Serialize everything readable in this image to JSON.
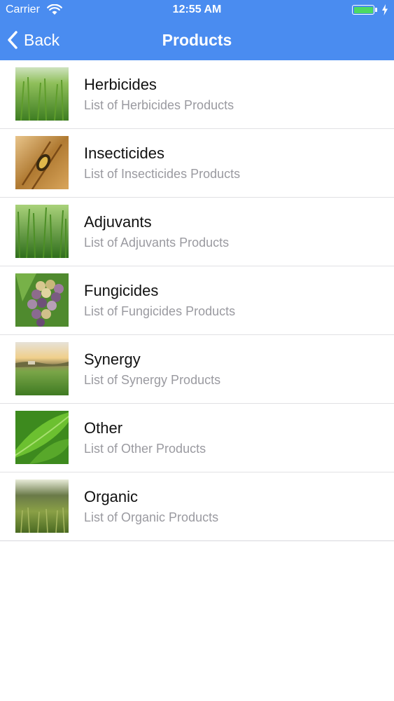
{
  "status_bar": {
    "carrier": "Carrier",
    "time": "12:55 AM"
  },
  "nav": {
    "back_label": "Back",
    "title": "Products"
  },
  "colors": {
    "nav_background": "#4a8cf0",
    "battery": "#4cd964",
    "subtitle": "#9a9aa0"
  },
  "products": [
    {
      "title": "Herbicides",
      "subtitle": "List of Herbicides Products",
      "thumbnail": "green-wheat-field-photo"
    },
    {
      "title": "Insecticides",
      "subtitle": "List of Insecticides Products",
      "thumbnail": "insect-on-wheat-photo"
    },
    {
      "title": "Adjuvants",
      "subtitle": "List of Adjuvants Products",
      "thumbnail": "green-grass-photo"
    },
    {
      "title": "Fungicides",
      "subtitle": "List of Fungicides Products",
      "thumbnail": "grape-cluster-photo"
    },
    {
      "title": "Synergy",
      "subtitle": "List of Synergy Products",
      "thumbnail": "field-sunset-photo"
    },
    {
      "title": "Other",
      "subtitle": "List of Other Products",
      "thumbnail": "green-leaves-photo"
    },
    {
      "title": "Organic",
      "subtitle": "List of Organic Products",
      "thumbnail": "misty-meadow-photo"
    }
  ]
}
